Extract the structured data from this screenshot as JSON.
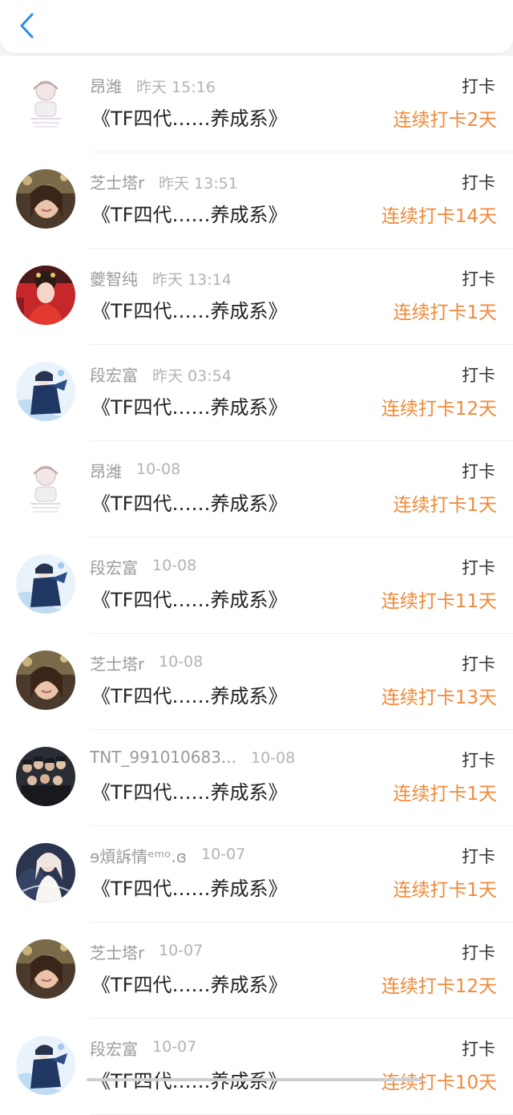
{
  "colors": {
    "accent_blue": "#2d8cf0",
    "streak_orange": "#f08a3a",
    "name_gray": "#9a9a9a"
  },
  "header": {
    "back_icon": "chevron-left-icon"
  },
  "items": [
    {
      "name": "昂潍",
      "time": "昨天 15:16",
      "title": "《TF四代……养成系》",
      "action": "打卡",
      "streak": "连续打卡2天",
      "avatar": "anime-girl"
    },
    {
      "name": "芝士塔r",
      "time": "昨天 13:51",
      "title": "《TF四代……养成系》",
      "action": "打卡",
      "streak": "连续打卡14天",
      "avatar": "woman-selfie"
    },
    {
      "name": "夔智纯",
      "time": "昨天 13:14",
      "title": "《TF四代……养成系》",
      "action": "打卡",
      "streak": "连续打卡1天",
      "avatar": "opera-red"
    },
    {
      "name": "段宏富",
      "time": "昨天 03:54",
      "title": "《TF四代……养成系》",
      "action": "打卡",
      "streak": "连续打卡12天",
      "avatar": "anime-blue"
    },
    {
      "name": "昂潍",
      "time": "10-08",
      "title": "《TF四代……养成系》",
      "action": "打卡",
      "streak": "连续打卡1天",
      "avatar": "anime-girl"
    },
    {
      "name": "段宏富",
      "time": "10-08",
      "title": "《TF四代……养成系》",
      "action": "打卡",
      "streak": "连续打卡11天",
      "avatar": "anime-blue"
    },
    {
      "name": "芝士塔r",
      "time": "10-08",
      "title": "《TF四代……养成系》",
      "action": "打卡",
      "streak": "连续打卡13天",
      "avatar": "woman-selfie"
    },
    {
      "name": "TNT_991010683...",
      "time": "10-08",
      "title": "《TF四代……养成系》",
      "action": "打卡",
      "streak": "连续打卡1天",
      "avatar": "group-photo"
    },
    {
      "name": "ɘ煩訴情ᵉᵐᵒ.ɞ",
      "time": "10-07",
      "title": "《TF四代……养成系》",
      "action": "打卡",
      "streak": "连续打卡1天",
      "avatar": "girl-white"
    },
    {
      "name": "芝士塔r",
      "time": "10-07",
      "title": "《TF四代……养成系》",
      "action": "打卡",
      "streak": "连续打卡12天",
      "avatar": "woman-selfie"
    },
    {
      "name": "段宏富",
      "time": "10-07",
      "title": "《TF四代……养成系》",
      "action": "打卡",
      "streak": "连续打卡10天",
      "avatar": "anime-blue"
    }
  ]
}
